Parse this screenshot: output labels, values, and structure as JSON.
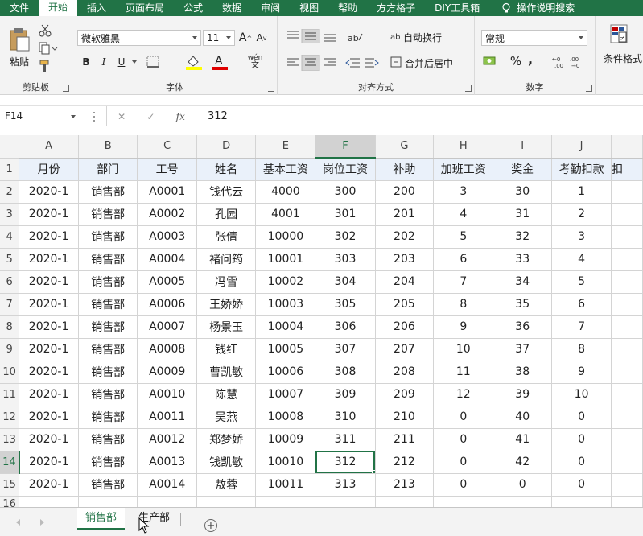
{
  "tabs": [
    "文件",
    "开始",
    "插入",
    "页面布局",
    "公式",
    "数据",
    "审阅",
    "视图",
    "帮助",
    "方方格子",
    "DIY工具箱"
  ],
  "tell_me": "操作说明搜索",
  "ribbon": {
    "clipboard": {
      "label": "剪贴板",
      "paste": "粘贴"
    },
    "font": {
      "label": "字体",
      "font_name": "微软雅黑",
      "font_size": "11",
      "bold": "B",
      "italic": "I",
      "underline": "U",
      "grow": "A",
      "shrink": "A",
      "phonetic": "wén"
    },
    "alignment": {
      "label": "对齐方式",
      "wrap": "自动换行",
      "merge": "合并后居中"
    },
    "number": {
      "label": "数字",
      "format": "常规",
      "percent": "%",
      "comma": ","
    },
    "styles": {
      "conditional": "条件格式"
    }
  },
  "formula_bar": {
    "name_box": "F14",
    "value": "312"
  },
  "columns": [
    "A",
    "B",
    "C",
    "D",
    "E",
    "F",
    "G",
    "H",
    "I",
    "J"
  ],
  "headers": [
    "月份",
    "部门",
    "工号",
    "姓名",
    "基本工资",
    "岗位工资",
    "补助",
    "加班工资",
    "奖金",
    "考勤扣款",
    "扣"
  ],
  "rows": [
    [
      "2020-1",
      "销售部",
      "A0001",
      "钱代云",
      "4000",
      "300",
      "200",
      "3",
      "30",
      "1"
    ],
    [
      "2020-1",
      "销售部",
      "A0002",
      "孔园",
      "4001",
      "301",
      "201",
      "4",
      "31",
      "2"
    ],
    [
      "2020-1",
      "销售部",
      "A0003",
      "张倩",
      "10000",
      "302",
      "202",
      "5",
      "32",
      "3"
    ],
    [
      "2020-1",
      "销售部",
      "A0004",
      "褚问筠",
      "10001",
      "303",
      "203",
      "6",
      "33",
      "4"
    ],
    [
      "2020-1",
      "销售部",
      "A0005",
      "冯雪",
      "10002",
      "304",
      "204",
      "7",
      "34",
      "5"
    ],
    [
      "2020-1",
      "销售部",
      "A0006",
      "王娇娇",
      "10003",
      "305",
      "205",
      "8",
      "35",
      "6"
    ],
    [
      "2020-1",
      "销售部",
      "A0007",
      "杨景玉",
      "10004",
      "306",
      "206",
      "9",
      "36",
      "7"
    ],
    [
      "2020-1",
      "销售部",
      "A0008",
      "钱红",
      "10005",
      "307",
      "207",
      "10",
      "37",
      "8"
    ],
    [
      "2020-1",
      "销售部",
      "A0009",
      "曹凯敏",
      "10006",
      "308",
      "208",
      "11",
      "38",
      "9"
    ],
    [
      "2020-1",
      "销售部",
      "A0010",
      "陈慧",
      "10007",
      "309",
      "209",
      "12",
      "39",
      "10"
    ],
    [
      "2020-1",
      "销售部",
      "A0011",
      "吴燕",
      "10008",
      "310",
      "210",
      "0",
      "40",
      "0"
    ],
    [
      "2020-1",
      "销售部",
      "A0012",
      "郑梦娇",
      "10009",
      "311",
      "211",
      "0",
      "41",
      "0"
    ],
    [
      "2020-1",
      "销售部",
      "A0013",
      "钱凯敏",
      "10010",
      "312",
      "212",
      "0",
      "42",
      "0"
    ],
    [
      "2020-1",
      "销售部",
      "A0014",
      "敖蓉",
      "10011",
      "313",
      "213",
      "0",
      "0",
      "0"
    ]
  ],
  "sheets": [
    "销售部",
    "生产部"
  ],
  "colors": {
    "accent": "#217346",
    "header_fill": "#eaf1fa"
  }
}
